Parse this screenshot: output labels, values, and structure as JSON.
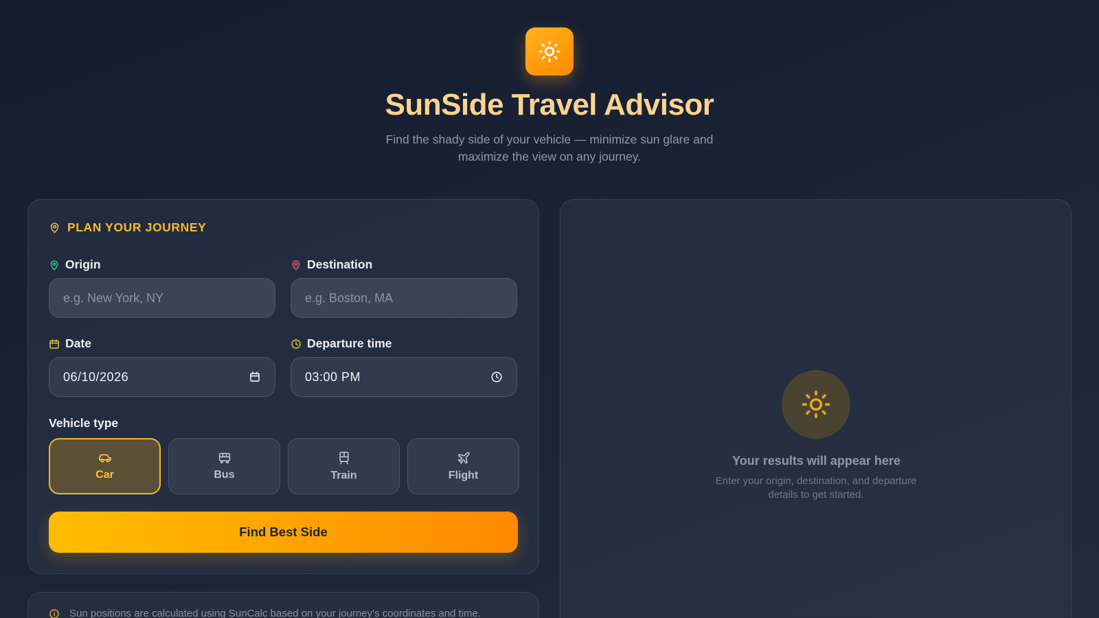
{
  "header": {
    "logo_icon": "sun-icon",
    "title": "SunSide Travel Advisor",
    "subtitle": "Find the shady side of your vehicle — minimize sun glare and maximize the view on any journey."
  },
  "form": {
    "section_title": "PLAN YOUR JOURNEY",
    "origin": {
      "label": "Origin",
      "placeholder": "e.g. New York, NY",
      "value": ""
    },
    "destination": {
      "label": "Destination",
      "placeholder": "e.g. Boston, MA",
      "value": ""
    },
    "date": {
      "label": "Date",
      "value": "06/10/2026"
    },
    "time": {
      "label": "Departure time",
      "value": "03:00 PM"
    },
    "vehicle_label": "Vehicle type",
    "vehicles": [
      {
        "label": "Car",
        "icon": "car-icon",
        "selected": true
      },
      {
        "label": "Bus",
        "icon": "bus-icon",
        "selected": false
      },
      {
        "label": "Train",
        "icon": "train-icon",
        "selected": false
      },
      {
        "label": "Flight",
        "icon": "plane-icon",
        "selected": false
      }
    ],
    "submit_label": "Find Best Side"
  },
  "results": {
    "title": "Your results will appear here",
    "subtitle": "Enter your origin, destination, and departure details to get started."
  },
  "note": {
    "text": "Sun positions are calculated using SunCalc based on your journey's coordinates and time."
  },
  "colors": {
    "accent": "#f5bc2c",
    "title": "#fcd38e",
    "origin_pin": "#2fbf8a",
    "destination_pin": "#e0566a",
    "background": "#1a2336"
  }
}
